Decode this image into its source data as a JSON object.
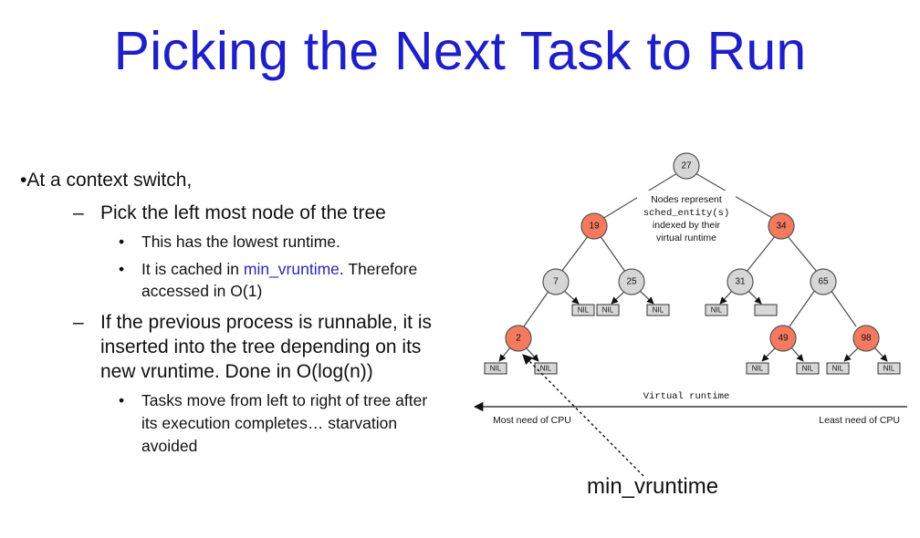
{
  "slide": {
    "title": "Picking the Next Task to Run",
    "bullets": {
      "b1": "•At a context switch,",
      "dash1": "–",
      "s1": "Pick the left most node of the tree",
      "dot1": "•",
      "s1a": "This has the lowest runtime.",
      "dot2": "•",
      "s1b_pre": "It is cached in ",
      "s1b_hl": "min_vruntime",
      "s1b_post": ". Therefore",
      "s1b_line2": "accessed in O(1)",
      "dash2": "–",
      "s2_line1": "If the previous process is runnable, it is",
      "s2_line2": "inserted into the tree depending on its",
      "s2_line3": "new vruntime. Done in O(log(n))",
      "dot3": "•",
      "s2a_line1": "Tasks move from left to right of tree after",
      "s2a_line2": "its execution completes… starvation",
      "s2a_line3": "avoided"
    }
  },
  "tree": {
    "nodes": [
      {
        "id": "n27",
        "label": "27",
        "color": "gray"
      },
      {
        "id": "n19",
        "label": "19",
        "color": "red"
      },
      {
        "id": "n34",
        "label": "34",
        "color": "red"
      },
      {
        "id": "n7",
        "label": "7",
        "color": "gray"
      },
      {
        "id": "n25",
        "label": "25",
        "color": "gray"
      },
      {
        "id": "n31",
        "label": "31",
        "color": "gray"
      },
      {
        "id": "n65",
        "label": "65",
        "color": "gray"
      },
      {
        "id": "n2",
        "label": "2",
        "color": "red"
      },
      {
        "id": "n49",
        "label": "49",
        "color": "red"
      },
      {
        "id": "n98",
        "label": "98",
        "color": "red"
      }
    ],
    "nil_label": "NIL",
    "caption_line1": "Nodes represent",
    "caption_line2": "sched_entity(s)",
    "caption_line3": "indexed by their",
    "caption_line4": "virtual runtime",
    "axis_label": "Virtual runtime",
    "left_label": "Most need of CPU",
    "right_label": "Least need of CPU",
    "pointer_label": "min_vruntime",
    "colors": {
      "red": "#f47a5f",
      "gray": "#d6d6d6",
      "nil": "#d8d8d8",
      "stroke": "#555555"
    }
  }
}
